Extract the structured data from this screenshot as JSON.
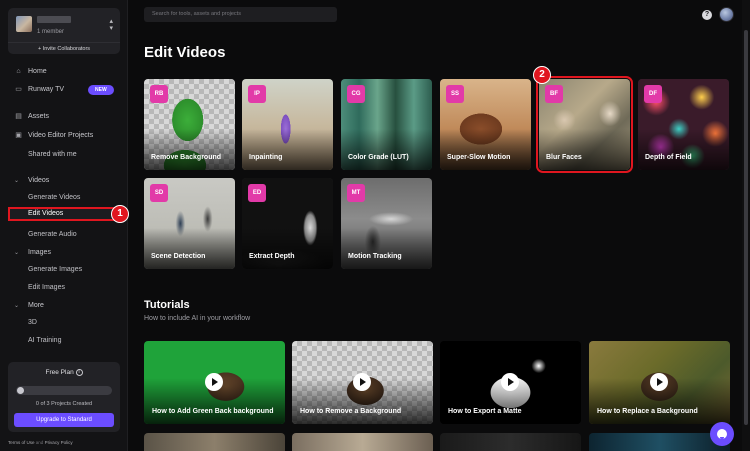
{
  "workspace": {
    "members": "1 member",
    "invite": "+ Invite Collaborators"
  },
  "nav": {
    "home": "Home",
    "runway_tv": "Runway TV",
    "runway_tv_badge": "NEW",
    "assets": "Assets",
    "projects": "Video Editor Projects",
    "shared": "Shared with me"
  },
  "sections": {
    "videos": {
      "label": "Videos",
      "items": [
        "Generate Videos",
        "Edit Videos",
        "Generate Audio"
      ]
    },
    "images": {
      "label": "Images",
      "items": [
        "Generate Images",
        "Edit Images"
      ]
    },
    "more": {
      "label": "More",
      "items": [
        "3D",
        "AI Training"
      ]
    }
  },
  "plan": {
    "title": "Free Plan",
    "progress": 0.0,
    "count": "0 of 3 Projects Created",
    "upgrade": "Upgrade to Standard"
  },
  "legal": {
    "terms": "Terms of Use",
    "and": "and",
    "privacy": "Privacy Policy"
  },
  "search": {
    "placeholder": "Search for tools, assets and projects"
  },
  "header": {
    "help": "?"
  },
  "page": {
    "title": "Edit Videos",
    "tools": [
      {
        "abbr": "RB",
        "name": "Remove Background"
      },
      {
        "abbr": "IP",
        "name": "Inpainting"
      },
      {
        "abbr": "CG",
        "name": "Color Grade (LUT)"
      },
      {
        "abbr": "SS",
        "name": "Super-Slow Motion"
      },
      {
        "abbr": "BF",
        "name": "Blur Faces"
      },
      {
        "abbr": "DF",
        "name": "Depth of Field"
      },
      {
        "abbr": "SD",
        "name": "Scene Detection"
      },
      {
        "abbr": "ED",
        "name": "Extract Depth"
      },
      {
        "abbr": "MT",
        "name": "Motion Tracking"
      }
    ]
  },
  "tutorials": {
    "title": "Tutorials",
    "subtitle": "How to include AI in your workflow",
    "items": [
      "How to Add Green Back background",
      "How to Remove a Background",
      "How to Export a Matte",
      "How to Replace a Background"
    ]
  },
  "callouts": [
    "1",
    "2"
  ],
  "colors": {
    "accent": "#6b4dff",
    "tag": "#e23aa8",
    "highlight": "#e0161f"
  }
}
